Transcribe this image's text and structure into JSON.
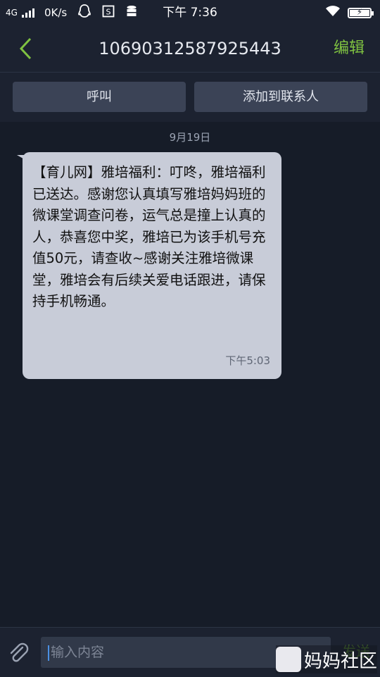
{
  "status_bar": {
    "network": "4G",
    "speed": "0K/s",
    "time": "下午 7:36"
  },
  "header": {
    "title": "10690312587925443",
    "edit_label": "编辑"
  },
  "actions": {
    "call_label": "呼叫",
    "add_contact_label": "添加到联系人"
  },
  "conversation": {
    "date": "9月19日",
    "messages": [
      {
        "text": "【育儿网】雅培福利：叮咚，雅培福利已送达。感谢您认真填写雅培妈妈班的微课堂调查问卷，运气总是撞上认真的人，恭喜您中奖，雅培已为该手机号充值50元，请查收~感谢关注雅培微课堂，雅培会有后续关爱电话跟进，请保持手机畅通。",
        "time": "下午5:03"
      }
    ]
  },
  "composer": {
    "placeholder": "输入内容",
    "send_label": "发送"
  },
  "watermark": {
    "text": "妈妈社区"
  },
  "colors": {
    "accent": "#7fc241",
    "background": "#161c28",
    "bubble": "#c8ccd8"
  }
}
